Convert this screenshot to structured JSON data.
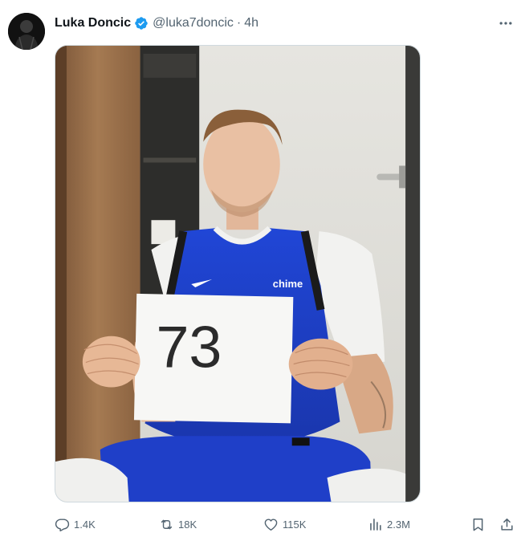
{
  "post": {
    "author": {
      "display_name": "Luka Doncic",
      "handle": "@luka7doncic",
      "verified": true,
      "verified_color": "#1d9bf0"
    },
    "separator": "·",
    "time_ago": "4h",
    "media": {
      "jersey_brand": "chime",
      "sign_number": "73"
    },
    "metrics": {
      "replies": "1.4K",
      "reposts": "18K",
      "likes": "115K",
      "views": "2.3M"
    }
  },
  "icons": {
    "more": "more-horizontal-icon",
    "reply": "reply-icon",
    "repost": "repost-icon",
    "like": "heart-icon",
    "views": "analytics-icon",
    "bookmark": "bookmark-icon",
    "share": "share-icon"
  },
  "colors": {
    "text_primary": "#0f1419",
    "text_secondary": "#536471",
    "accent": "#1d9bf0",
    "jersey_blue": "#1e3fc4"
  }
}
